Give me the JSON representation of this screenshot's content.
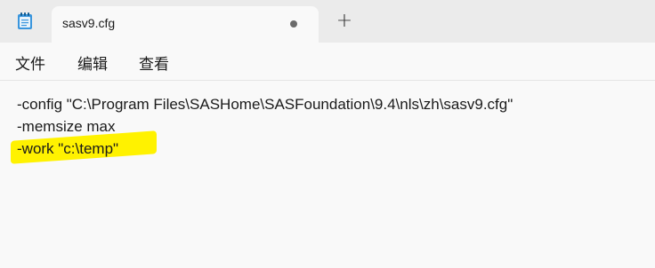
{
  "tab": {
    "title": "sasv9.cfg"
  },
  "menu": {
    "items": [
      "文件",
      "编辑",
      "查看"
    ]
  },
  "editor": {
    "lines": [
      "-config \"C:\\Program Files\\SASHome\\SASFoundation\\9.4\\nls\\zh\\sasv9.cfg\"",
      "-memsize max",
      "-work \"c:\\temp\""
    ]
  },
  "colors": {
    "highlight": "#fff200",
    "tabstrip": "#ebebeb",
    "background": "#f9f9f9"
  },
  "icons": {
    "app": "notepad-icon",
    "unsaved": "unsaved-dot-icon",
    "newtab": "plus-icon"
  }
}
